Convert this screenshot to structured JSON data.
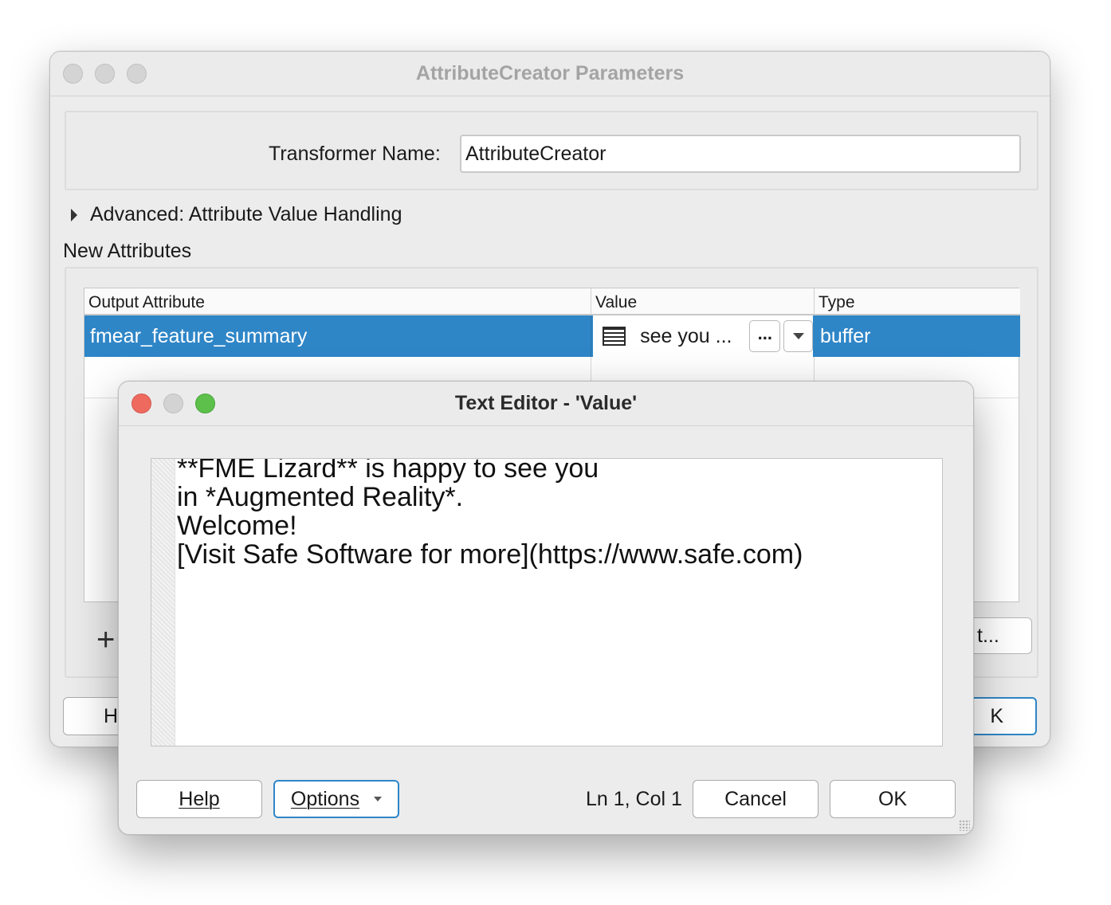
{
  "back_window": {
    "title": "AttributeCreator Parameters",
    "transformer_name_label": "Transformer Name:",
    "transformer_name_value": "AttributeCreator",
    "advanced_label": "Advanced: Attribute Value Handling",
    "section_label": "New Attributes",
    "table": {
      "columns": [
        "Output Attribute",
        "Value",
        "Type"
      ],
      "rows": [
        {
          "output_attribute": "fmear_feature_summary",
          "value": "see you  ...",
          "type": "buffer"
        }
      ]
    },
    "dots_label": "...",
    "add_icon": "+",
    "right_button_partial": "t...",
    "help_partial": "H",
    "ok_partial": "K"
  },
  "front_window": {
    "title": "Text Editor - 'Value'",
    "editor_lines": [
      "**FME Lizard** is happy to see you",
      "in *Augmented Reality*.",
      "Welcome!",
      "[Visit Safe Software for more](https://www.safe.com)"
    ],
    "help_label": "Help",
    "options_label": "Options",
    "cursor_status": "Ln 1, Col 1",
    "cancel_label": "Cancel",
    "ok_label": "OK"
  },
  "colors": {
    "selection_blue": "#2f86c7",
    "close_red": "#ee6a5f",
    "zoom_green": "#5cc04a"
  }
}
